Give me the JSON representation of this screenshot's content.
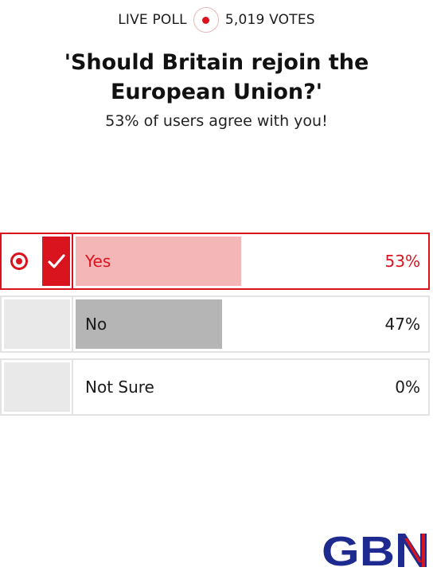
{
  "header": {
    "live_label": "LIVE POLL",
    "votes_label": "5,019 VOTES"
  },
  "question": "'Should Britain rejoin the European Union?'",
  "result_message": "53% of users agree with you!",
  "options": [
    {
      "label": "Yes",
      "percent_text": "53%",
      "percent": 53,
      "selected": true
    },
    {
      "label": "No",
      "percent_text": "47%",
      "percent": 47,
      "selected": false
    },
    {
      "label": "Not Sure",
      "percent_text": "0%",
      "percent": 0,
      "selected": false
    }
  ],
  "logo": {
    "text": "GBN",
    "icon": "gbnews-logo"
  },
  "colors": {
    "accent": "#d9141e",
    "selected_bar": "#f4b6b6",
    "other_bar": "#b5b5b5",
    "logo_blue": "#1e2a8f"
  }
}
